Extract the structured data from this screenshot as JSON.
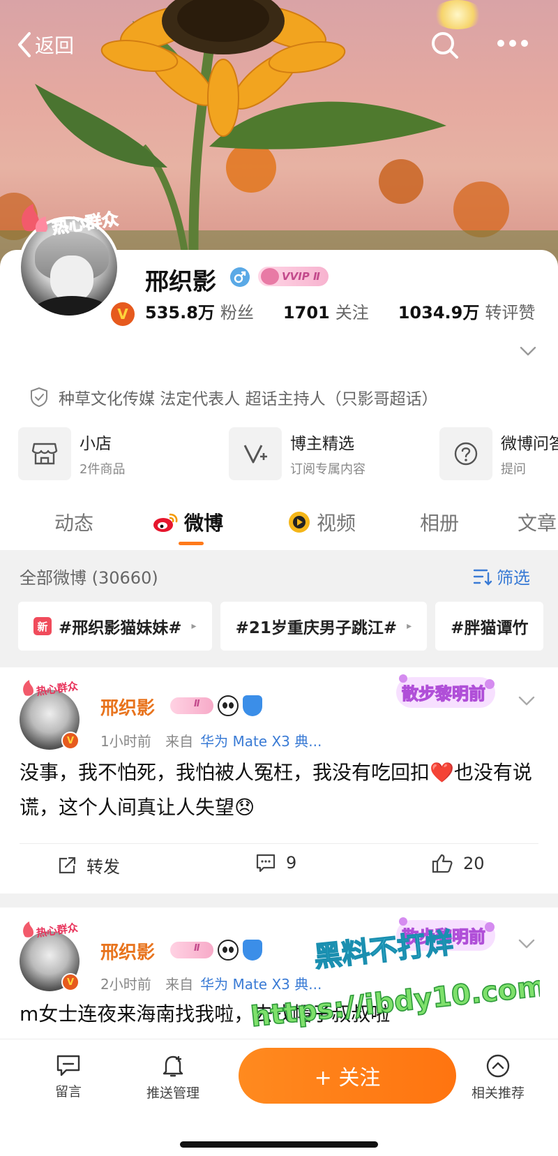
{
  "nav": {
    "back_label": "返回"
  },
  "profile": {
    "name": "邢织影",
    "vip_badge": "VVIP Ⅱ",
    "avatar_label": "热心群众",
    "verified_mark": "V",
    "stats": [
      {
        "value": "535.8万",
        "label": "粉丝"
      },
      {
        "value": "1701",
        "label": "关注"
      },
      {
        "value": "1034.9万",
        "label": "转评赞"
      }
    ],
    "certification": "种草文化传媒 法定代表人 超话主持人（只影哥超话）"
  },
  "features": [
    {
      "title": "小店",
      "subtitle": "2件商品",
      "icon": "shop-icon"
    },
    {
      "title": "博主精选",
      "subtitle": "订阅专属内容",
      "icon": "v-plus-icon"
    },
    {
      "title": "微博问答",
      "subtitle": "提问",
      "icon": "question-icon"
    }
  ],
  "tabs": [
    {
      "label": "动态"
    },
    {
      "label": "微博"
    },
    {
      "label": "视频"
    },
    {
      "label": "相册"
    },
    {
      "label": "文章"
    }
  ],
  "filter": {
    "title": "全部微博 (30660)",
    "button": "筛选",
    "topics": [
      {
        "label": "#邢织影猫妹妹#",
        "new_tag": "新"
      },
      {
        "label": "#21岁重庆男子跳江#"
      },
      {
        "label": "#胖猫谭竹"
      }
    ]
  },
  "posts": [
    {
      "author": "邢织影",
      "avatar_label": "热心群众",
      "verified_mark": "V",
      "vip_text": "Ⅱ",
      "time": "1小时前",
      "source_prefix": "来自",
      "source": "华为 Mate X3 典...",
      "deco": "散步黎明前",
      "text": "没事，我不怕死，我怕被人冤枉，我没有吃回扣❤️也没有说谎，这个人间真让人失望😞",
      "repost_label": "转发",
      "comments": "9",
      "likes": "20"
    },
    {
      "author": "邢织影",
      "avatar_label": "热心群众",
      "verified_mark": "V",
      "vip_text": "Ⅱ",
      "time": "2小时前",
      "source_prefix": "来自",
      "source": "华为 Mate X3 典...",
      "deco": "散步黎明前",
      "text": "m女士连夜来海南找我啦，去找帽子叔叔啦"
    }
  ],
  "watermark": {
    "line1": "黑料不打烊",
    "line2": "https://ibdy10.com"
  },
  "bottom_bar": {
    "message": "留言",
    "push": "推送管理",
    "follow": "+ 关注",
    "recommend": "相关推荐"
  },
  "colors": {
    "accent": "#ff7a1a",
    "link": "#3a7bd5",
    "username": "#e8741e"
  }
}
